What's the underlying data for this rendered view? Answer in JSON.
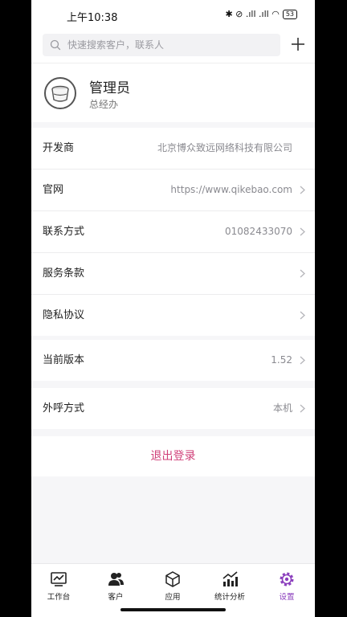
{
  "status": {
    "time": "上午10:38",
    "icons_text": "✱ ⊘ .ıll .ıll ◠",
    "battery": "53"
  },
  "search": {
    "placeholder": "快速搜索客户，联系人"
  },
  "profile": {
    "name": "管理员",
    "title": "总经办"
  },
  "info_group": [
    {
      "label": "开发商",
      "value": "北京博众致远网络科技有限公司"
    },
    {
      "label": "官网",
      "value": "https://www.qikebao.com"
    },
    {
      "label": "联系方式",
      "value": "01082433070"
    },
    {
      "label": "服务条款",
      "value": ""
    },
    {
      "label": "隐私协议",
      "value": ""
    }
  ],
  "version": {
    "label": "当前版本",
    "value": "1.52"
  },
  "call_mode": {
    "label": "外呼方式",
    "value": "本机"
  },
  "logout_label": "退出登录",
  "tabs": [
    {
      "label": "工作台",
      "icon": "monitor-chart-icon"
    },
    {
      "label": "客户",
      "icon": "users-icon"
    },
    {
      "label": "应用",
      "icon": "cube-icon"
    },
    {
      "label": "统计分析",
      "icon": "bar-chart-icon"
    },
    {
      "label": "设置",
      "icon": "gear-icon"
    }
  ],
  "colors": {
    "accent": "#8b3fbd",
    "logout": "#d0417a"
  }
}
